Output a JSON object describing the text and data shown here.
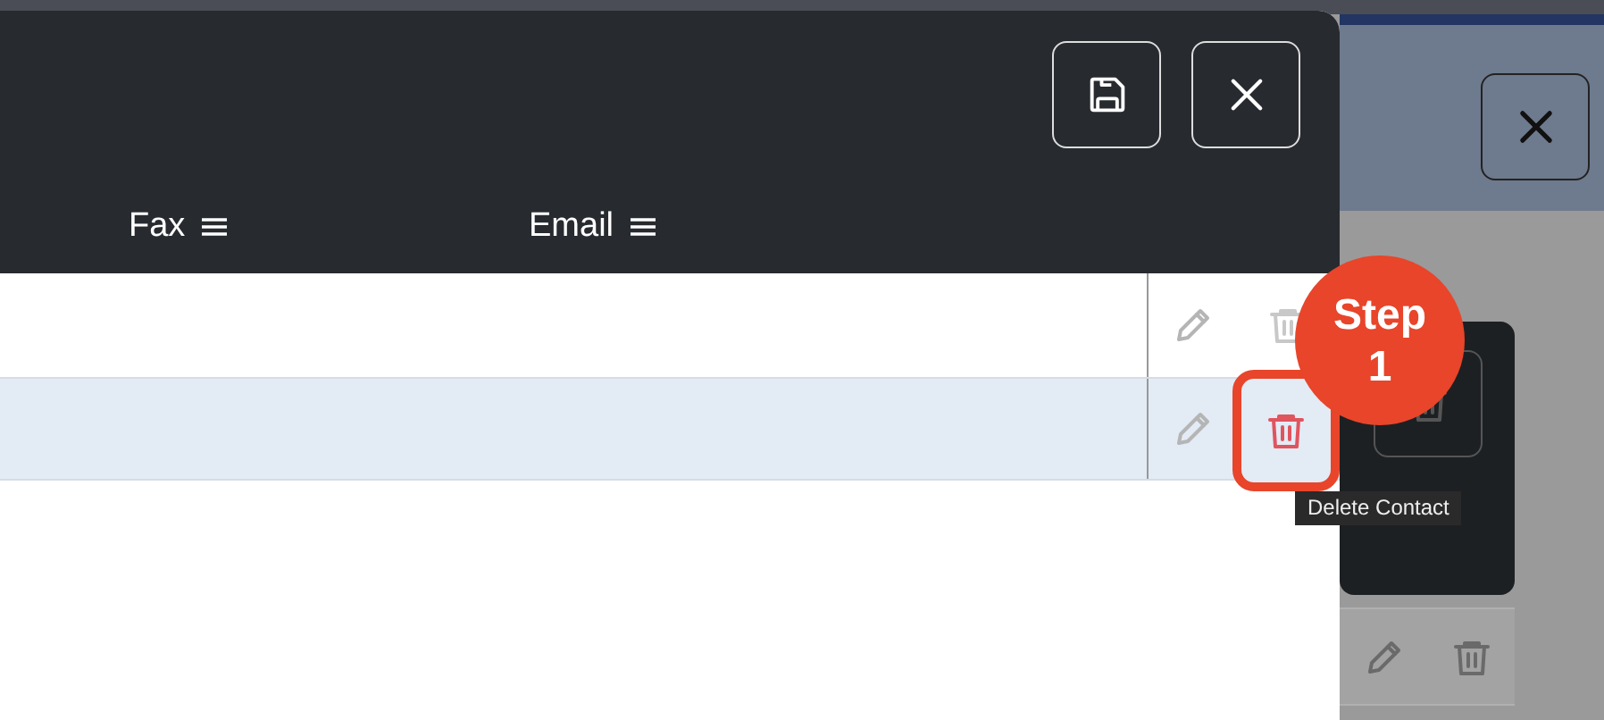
{
  "dialog": {
    "header_buttons": [
      {
        "kind": "save"
      },
      {
        "kind": "close"
      }
    ],
    "columns": [
      {
        "label": "Fax"
      },
      {
        "label": "Email"
      }
    ],
    "rows": [
      {
        "selected": false,
        "delete_highlighted": false
      },
      {
        "selected": true,
        "delete_highlighted": true
      }
    ]
  },
  "callout": {
    "label": "Step",
    "number": "1"
  },
  "tooltip": "Delete Contact",
  "background": {
    "close_button": true
  }
}
